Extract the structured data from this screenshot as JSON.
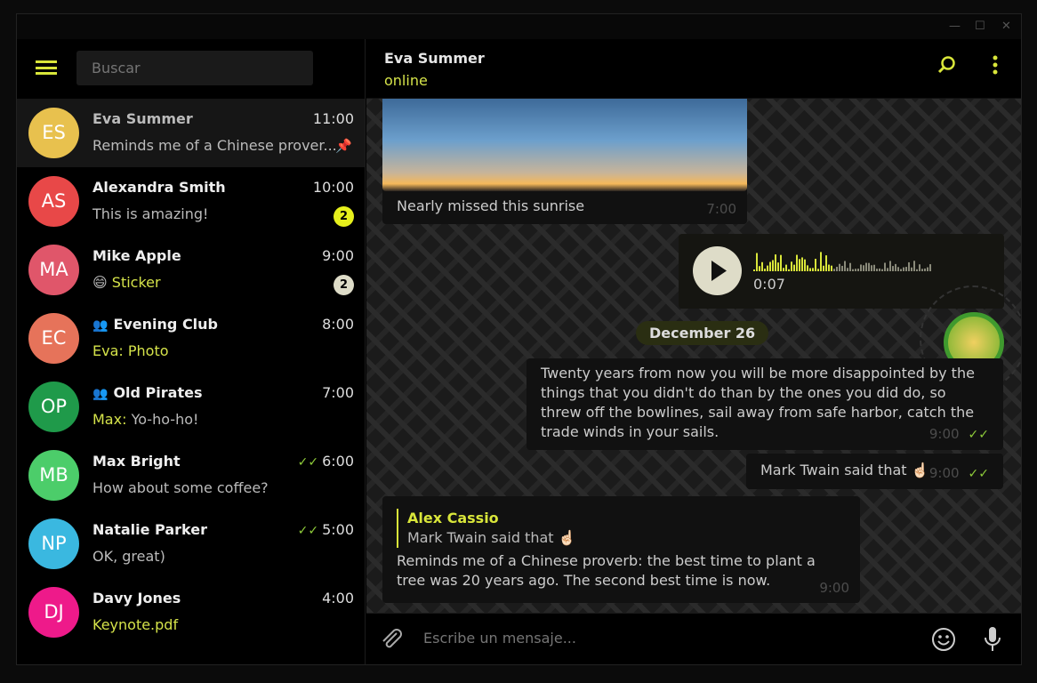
{
  "colors": {
    "accent": "#d9e63a",
    "badge_unread": "#e6f01c",
    "badge_muted": "#dedcc8"
  },
  "search": {
    "placeholder": "Buscar"
  },
  "window_controls": {
    "minimize": "—",
    "maximize": "☐",
    "close": "✕"
  },
  "chats": [
    {
      "initials": "ES",
      "name": "Eva Summer",
      "time": "11:00",
      "preview": "Reminds me of a Chinese prover...",
      "color": "#e8c14e",
      "pinned": true
    },
    {
      "initials": "AS",
      "name": "Alexandra Smith",
      "time": "10:00",
      "preview": "This is amazing!",
      "color": "#e84848",
      "badge": "2",
      "badge_color": "#e6f01c"
    },
    {
      "initials": "MA",
      "name": "Mike Apple",
      "time": "9:00",
      "preview_emoji": "😄",
      "preview": "Sticker",
      "preview_highlight": true,
      "color": "#e0566a",
      "badge": "2",
      "badge_color": "#dedcc8"
    },
    {
      "initials": "EC",
      "name": "Evening Club",
      "group": true,
      "time": "8:00",
      "preview": "Eva: Photo",
      "preview_highlight": true,
      "color": "#e6735a"
    },
    {
      "initials": "OP",
      "name": "Old Pirates",
      "group": true,
      "time": "7:00",
      "sender": "Max:",
      "preview": "Yo-ho-ho!",
      "color": "#1f9a4a"
    },
    {
      "initials": "MB",
      "name": "Max Bright",
      "time": "6:00",
      "read": true,
      "preview": "How about some coffee?",
      "color": "#4ccd6a"
    },
    {
      "initials": "NP",
      "name": "Natalie Parker",
      "time": "5:00",
      "read": true,
      "preview": "OK, great)",
      "color": "#3ab8e0"
    },
    {
      "initials": "DJ",
      "name": "Davy Jones",
      "time": "4:00",
      "preview": "Keynote.pdf",
      "preview_highlight": true,
      "color": "#ee1a8a"
    }
  ],
  "header": {
    "title": "Eva Summer",
    "status": "online"
  },
  "messages": {
    "photo_caption": "Nearly missed this sunrise",
    "photo_time": "7:00",
    "voice_duration": "0:07",
    "date": "December 26",
    "quote": "Twenty years from now you will be more disappointed by the things that you didn't do than by the ones you did do, so threw off the bowlines, sail away from safe harbor, catch the trade winds in your sails.",
    "quote_time": "9:00",
    "twain": "Mark Twain said that ☝🏻",
    "twain_time": "9:00",
    "reply_author": "Alex Cassio",
    "reply_quote": "Mark Twain said that ☝🏻",
    "reply_text": "Reminds me of a Chinese proverb: the best time to plant a tree was 20 years ago. The second best time is now.",
    "reply_time": "9:00"
  },
  "composer": {
    "placeholder": "Escribe un mensaje..."
  }
}
